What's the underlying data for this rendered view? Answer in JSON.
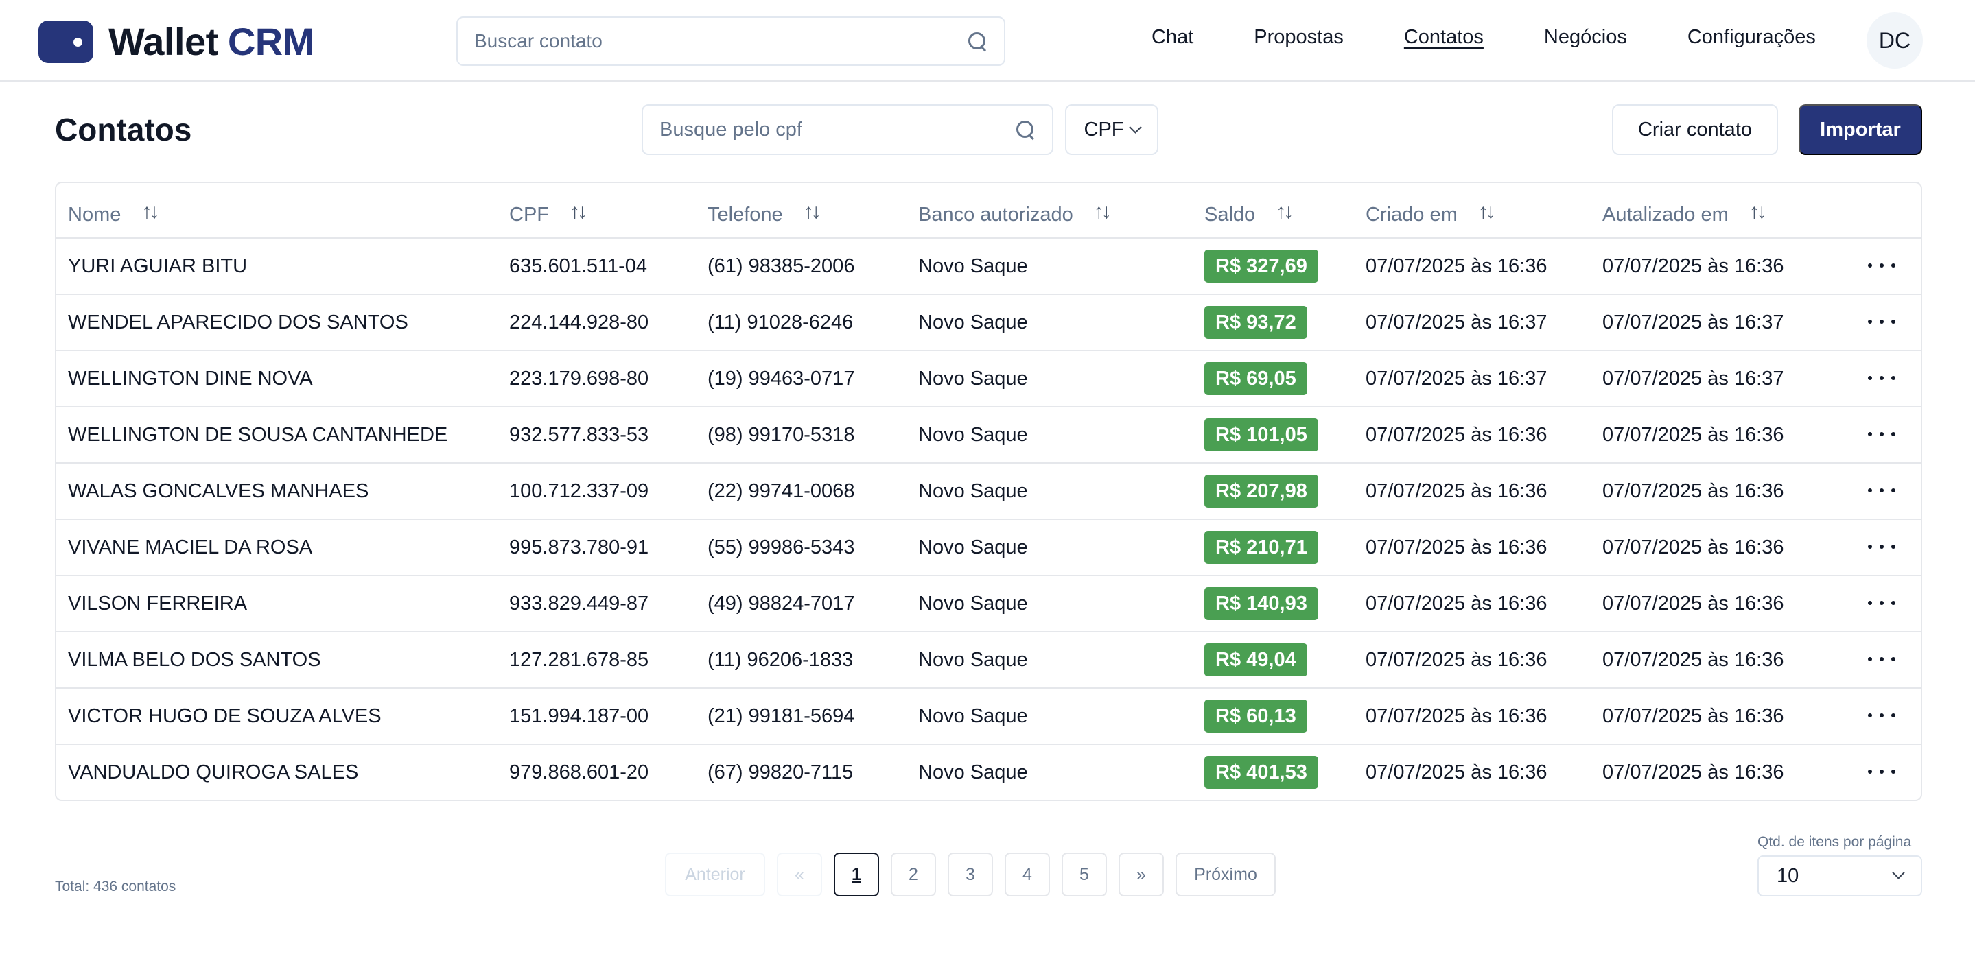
{
  "header": {
    "logo_word": "Wallet",
    "logo_accent": "CRM",
    "search_placeholder": "Buscar contato",
    "nav": [
      "Chat",
      "Propostas",
      "Contatos",
      "Negócios",
      "Configurações"
    ],
    "nav_active": "Contatos",
    "avatar_initials": "DC"
  },
  "page": {
    "title": "Contatos",
    "cpf_search_placeholder": "Busque pelo cpf",
    "filter_value": "CPF",
    "create_label": "Criar contato",
    "import_label": "Importar"
  },
  "colors": {
    "brand": "#26357a",
    "saldo_badge": "#4a9f52",
    "muted_text": "#64748b"
  },
  "icons": {
    "search": "search-icon",
    "sort": "sort-icon",
    "more": "more-horizontal-icon",
    "chevron": "chevron-down-icon"
  },
  "table": {
    "headers": [
      "Nome",
      "CPF",
      "Telefone",
      "Banco autorizado",
      "Saldo",
      "Criado em",
      "Autalizado em"
    ],
    "rows": [
      {
        "nome": "YURI AGUIAR BITU",
        "cpf": "635.601.511-04",
        "telefone": "(61) 98385-2006",
        "banco": "Novo Saque",
        "saldo": "R$ 327,69",
        "criado": "07/07/2025 às 16:36",
        "atualizado": "07/07/2025 às 16:36"
      },
      {
        "nome": "WENDEL APARECIDO DOS SANTOS",
        "cpf": "224.144.928-80",
        "telefone": "(11) 91028-6246",
        "banco": "Novo Saque",
        "saldo": "R$ 93,72",
        "criado": "07/07/2025 às 16:37",
        "atualizado": "07/07/2025 às 16:37"
      },
      {
        "nome": "WELLINGTON DINE NOVA",
        "cpf": "223.179.698-80",
        "telefone": "(19) 99463-0717",
        "banco": "Novo Saque",
        "saldo": "R$ 69,05",
        "criado": "07/07/2025 às 16:37",
        "atualizado": "07/07/2025 às 16:37"
      },
      {
        "nome": "WELLINGTON DE SOUSA CANTANHEDE",
        "cpf": "932.577.833-53",
        "telefone": "(98) 99170-5318",
        "banco": "Novo Saque",
        "saldo": "R$ 101,05",
        "criado": "07/07/2025 às 16:36",
        "atualizado": "07/07/2025 às 16:36"
      },
      {
        "nome": "WALAS GONCALVES MANHAES",
        "cpf": "100.712.337-09",
        "telefone": "(22) 99741-0068",
        "banco": "Novo Saque",
        "saldo": "R$ 207,98",
        "criado": "07/07/2025 às 16:36",
        "atualizado": "07/07/2025 às 16:36"
      },
      {
        "nome": "VIVANE MACIEL DA ROSA",
        "cpf": "995.873.780-91",
        "telefone": "(55) 99986-5343",
        "banco": "Novo Saque",
        "saldo": "R$ 210,71",
        "criado": "07/07/2025 às 16:36",
        "atualizado": "07/07/2025 às 16:36"
      },
      {
        "nome": "VILSON FERREIRA",
        "cpf": "933.829.449-87",
        "telefone": "(49) 98824-7017",
        "banco": "Novo Saque",
        "saldo": "R$ 140,93",
        "criado": "07/07/2025 às 16:36",
        "atualizado": "07/07/2025 às 16:36"
      },
      {
        "nome": "VILMA BELO DOS SANTOS",
        "cpf": "127.281.678-85",
        "telefone": "(11) 96206-1833",
        "banco": "Novo Saque",
        "saldo": "R$ 49,04",
        "criado": "07/07/2025 às 16:36",
        "atualizado": "07/07/2025 às 16:36"
      },
      {
        "nome": "VICTOR HUGO DE SOUZA ALVES",
        "cpf": "151.994.187-00",
        "telefone": "(21) 99181-5694",
        "banco": "Novo Saque",
        "saldo": "R$ 60,13",
        "criado": "07/07/2025 às 16:36",
        "atualizado": "07/07/2025 às 16:36"
      },
      {
        "nome": "VANDUALDO QUIROGA SALES",
        "cpf": "979.868.601-20",
        "telefone": "(67) 99820-7115",
        "banco": "Novo Saque",
        "saldo": "R$ 401,53",
        "criado": "07/07/2025 às 16:36",
        "atualizado": "07/07/2025 às 16:36"
      }
    ]
  },
  "footer": {
    "total": "Total: 436 contatos",
    "prev_label": "Anterior",
    "first_label": "«",
    "pages": [
      "1",
      "2",
      "3",
      "4",
      "5"
    ],
    "current_page": "1",
    "last_label": "»",
    "next_label": "Próximo",
    "per_page_label": "Qtd. de itens por página",
    "per_page_value": "10"
  }
}
